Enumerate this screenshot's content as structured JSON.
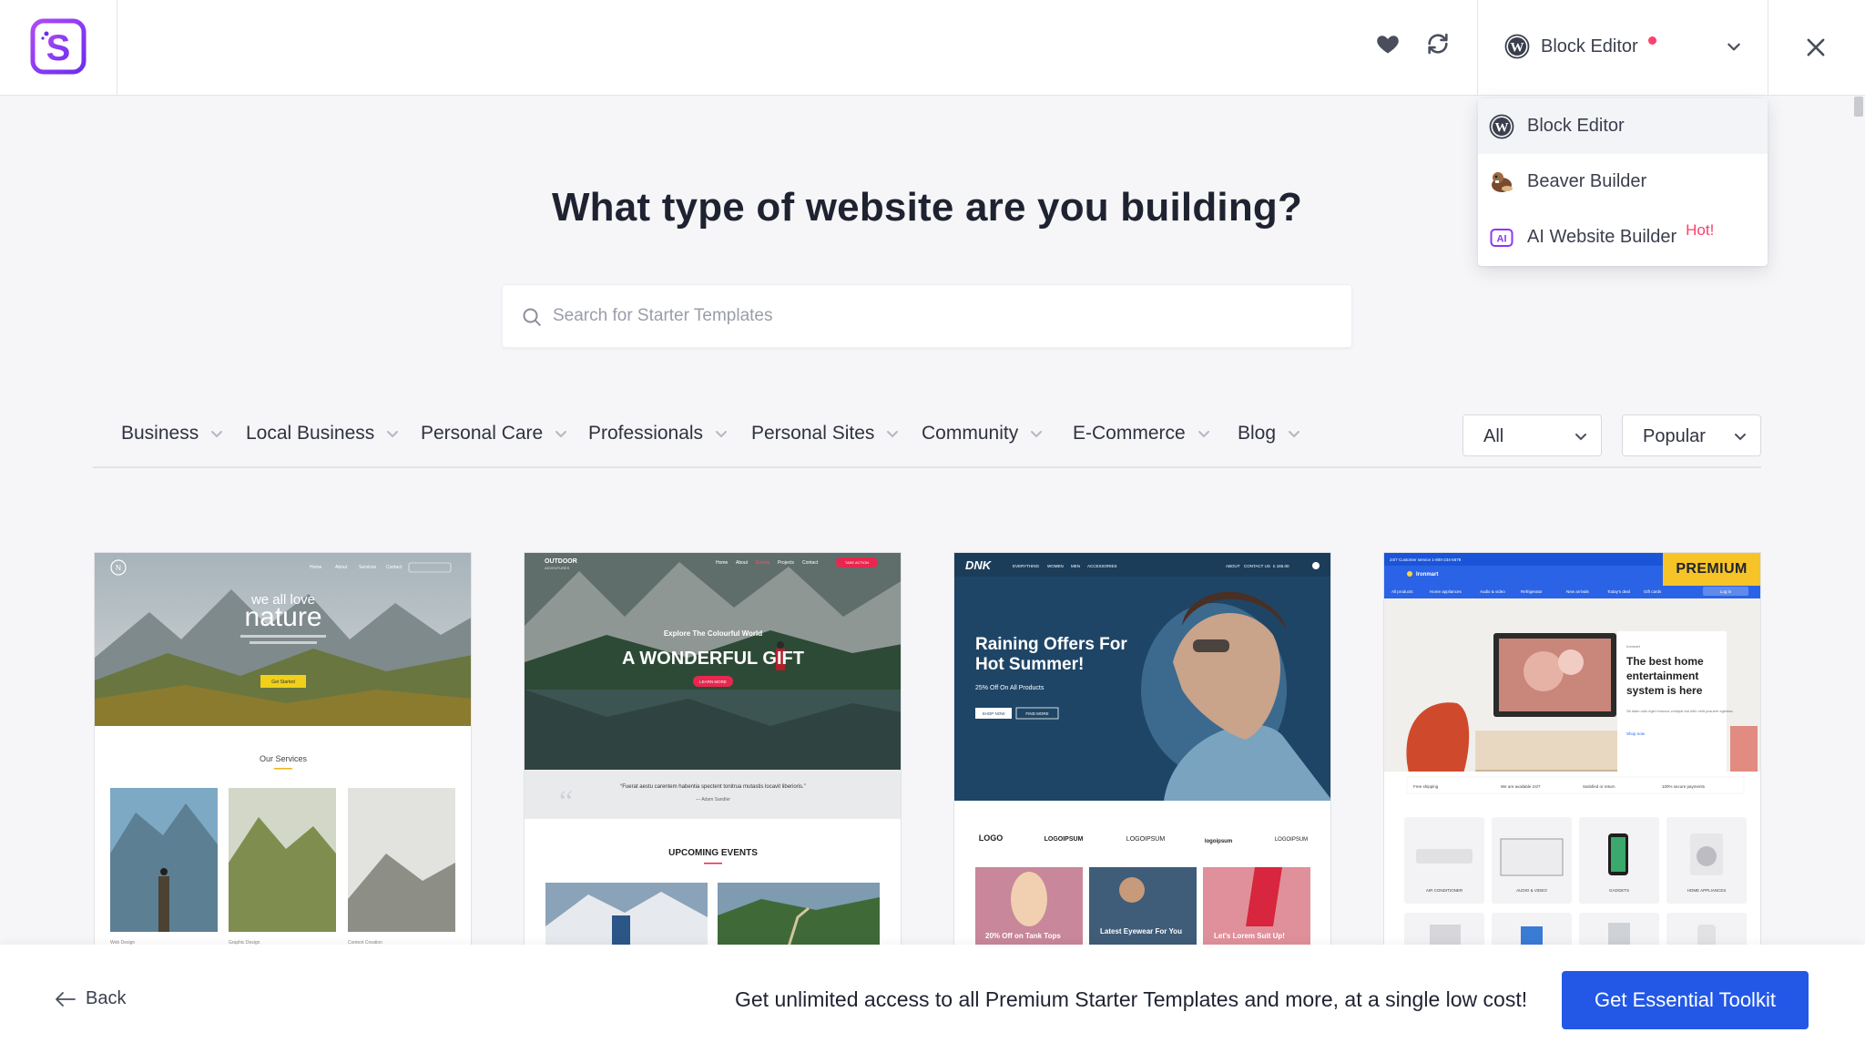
{
  "header": {
    "logo_letter": "S",
    "editor_selected": "Block Editor",
    "icons": [
      "heart-icon",
      "sync-icon",
      "wordpress-icon",
      "chevron-down-icon",
      "close-icon"
    ]
  },
  "dropdown": {
    "items": [
      {
        "label": "Block Editor",
        "icon": "wordpress-icon"
      },
      {
        "label": "Beaver Builder",
        "icon": "beaver-icon"
      },
      {
        "label": "AI Website Builder",
        "icon": "ai-icon",
        "badge": "Hot!"
      }
    ]
  },
  "main": {
    "title": "What type of website are you building?",
    "search_placeholder": "Search for Starter Templates",
    "categories": [
      "Business",
      "Local Business",
      "Personal Care",
      "Professionals",
      "Personal Sites",
      "Community",
      "E-Commerce",
      "Blog"
    ],
    "filter_type": "All",
    "sort": "Popular"
  },
  "cards": [
    {
      "nav": [
        "Home",
        "About",
        "Services",
        "Contact"
      ],
      "hero_small": "we all love",
      "hero_big": "nature",
      "cta": "Get Started",
      "section": "Our Services",
      "items": [
        "Web Design",
        "Graphic Design",
        "Content Creation"
      ]
    },
    {
      "brand": "OUTDOOR",
      "brand_sub": "ADVENTURES",
      "nav": [
        "Home",
        "About",
        "Events",
        "Projects",
        "Contact"
      ],
      "nav_cta": "TAKE ACTION",
      "kicker": "Explore The Colourful World",
      "title": "A WONDERFUL GIFT",
      "cta": "LEARN MORE",
      "quote": "“Fuerat aestu carentem habentia spectent tonitrua mutastis locavit liberioris.”",
      "quote_author": "— Adam Sandler",
      "section": "UPCOMING EVENTS"
    },
    {
      "brand": "DNK",
      "nav": [
        "EVERYTHING",
        "WOMEN",
        "MEN",
        "ACCESSORIES"
      ],
      "nav_right": [
        "ABOUT",
        "CONTACT US",
        "£ 165.00"
      ],
      "title_line1": "Raining Offers For",
      "title_line2": "Hot Summer!",
      "subtitle": "25% Off On All Products",
      "btn1": "SHOP NOW",
      "btn2": "FIND MORE",
      "logos": [
        "LOGO",
        "LOGOIPSUM",
        "LOGOIPSUM",
        "logoipsum",
        "LOGOIPSUM"
      ],
      "tiles": [
        "20% Off on Tank Tops",
        "Latest Eyewear For You",
        "Let's Lorem Suit Up!"
      ]
    },
    {
      "badge": "PREMIUM",
      "topbar": "24/7 Customer service 1-800-234-5678",
      "brand": "Ironmart",
      "nav": [
        "All products",
        "Home appliances",
        "Audio & video",
        "Refrigerator",
        "New arrivals",
        "Today's deal",
        "Gift cards"
      ],
      "login": "Log in",
      "hero_title": "The best home entertainment system is here",
      "hero_text": "Sit diam odio eget rhoncus volutpat est nibh velit posuere egestas.",
      "hero_link": "Shop now",
      "features": [
        "Free shipping",
        "We are available 24/7",
        "Satisfied or return",
        "100% secure payments"
      ],
      "products": [
        "AIR CONDITIONER",
        "AUDIO & VIDEO",
        "GADGETS",
        "HOME APPLIANCES"
      ]
    }
  ],
  "bottom": {
    "back": "Back",
    "promo": "Get unlimited access to all Premium Starter Templates and more, at a single low cost!",
    "cta": "Get Essential Toolkit"
  },
  "colors": {
    "accent": "#2358e6",
    "logo_purple": "#8f35f5",
    "hot": "#ff3f6c",
    "premium": "#f6c427"
  }
}
